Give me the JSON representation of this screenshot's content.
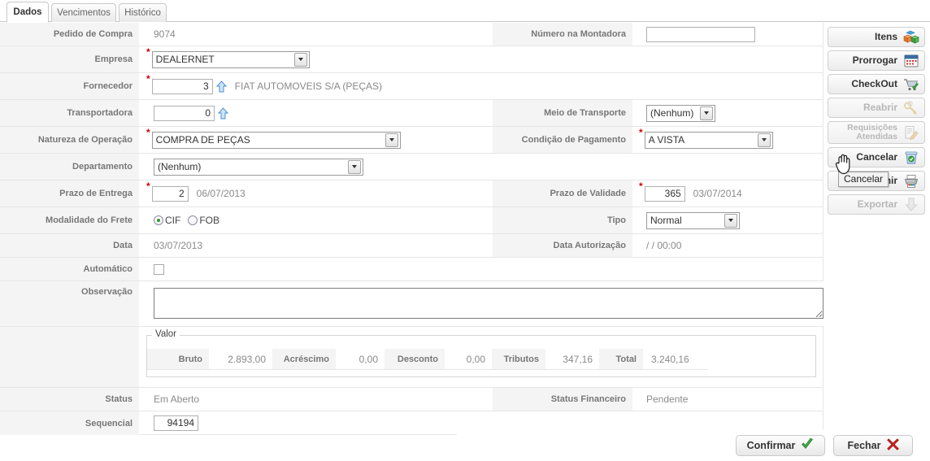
{
  "tabs": [
    {
      "label": "Dados",
      "active": true
    },
    {
      "label": "Vencimentos",
      "active": false
    },
    {
      "label": "Histórico",
      "active": false
    }
  ],
  "fields": {
    "pedido_de_compra": {
      "label": "Pedido de Compra",
      "value": "9074"
    },
    "numero_na_montadora": {
      "label": "Número na Montadora",
      "value": "",
      "placeholder": ""
    },
    "empresa": {
      "label": "Empresa",
      "value": "DEALERNET"
    },
    "fornecedor": {
      "label": "Fornecedor",
      "code": "3",
      "name": "FIAT AUTOMOVEIS S/A (PEÇAS)"
    },
    "transportadora": {
      "label": "Transportadora",
      "code": "0",
      "name": ""
    },
    "meio_de_transporte": {
      "label": "Meio de Transporte",
      "value": "(Nenhum)"
    },
    "natureza_de_operacao": {
      "label": "Natureza de Operação",
      "value": "COMPRA DE PEÇAS"
    },
    "condicao_de_pagamento": {
      "label": "Condição de Pagamento",
      "value": "A VISTA"
    },
    "departamento": {
      "label": "Departamento",
      "value": "(Nenhum)"
    },
    "prazo_de_entrega": {
      "label": "Prazo de Entrega",
      "days": "2",
      "date": "06/07/2013"
    },
    "prazo_de_validade": {
      "label": "Prazo de Validade",
      "days": "365",
      "date": "03/07/2014"
    },
    "modalidade_do_frete": {
      "label": "Modalidade do Frete",
      "options": [
        "CIF",
        "FOB"
      ],
      "selected": "CIF"
    },
    "tipo": {
      "label": "Tipo",
      "value": "Normal"
    },
    "data": {
      "label": "Data",
      "value": "03/07/2013"
    },
    "data_autorizacao": {
      "label": "Data Autorização",
      "value": "/ / 00:00"
    },
    "automatico": {
      "label": "Automático",
      "checked": false
    },
    "observacao": {
      "label": "Observação",
      "value": ""
    },
    "status": {
      "label": "Status",
      "value": "Em Aberto"
    },
    "status_financeiro": {
      "label": "Status Financeiro",
      "value": "Pendente"
    },
    "sequencial": {
      "label": "Sequencial",
      "value": "94194"
    }
  },
  "valor": {
    "legend": "Valor",
    "items": [
      {
        "label": "Bruto",
        "value": "2.893,00"
      },
      {
        "label": "Acréscimo",
        "value": "0,00"
      },
      {
        "label": "Desconto",
        "value": "0,00"
      },
      {
        "label": "Tributos",
        "value": "347,16"
      },
      {
        "label": "Total",
        "value": "3.240,16"
      }
    ]
  },
  "rail": [
    {
      "label": "Itens",
      "icon": "blocks-icon",
      "disabled": false,
      "two_line": false
    },
    {
      "label": "Prorrogar",
      "icon": "calendar-icon",
      "disabled": false,
      "two_line": false
    },
    {
      "label": "CheckOut",
      "icon": "cart-check-icon",
      "disabled": false,
      "two_line": false
    },
    {
      "label": "Reabrir",
      "icon": "keys-icon",
      "disabled": true,
      "two_line": false
    },
    {
      "label_line1": "Requisições",
      "label_line2": "Atendidas",
      "label": "Requisições Atendidas",
      "icon": "document-pencil-icon",
      "disabled": true,
      "two_line": true
    },
    {
      "label": "Cancelar",
      "icon": "trash-icon",
      "disabled": false,
      "two_line": false
    },
    {
      "label": "Imprimir",
      "icon": "printer-icon",
      "disabled": false,
      "two_line": false
    },
    {
      "label": "Exportar",
      "icon": "download-arrow-icon",
      "disabled": true,
      "two_line": false
    }
  ],
  "tooltip": {
    "text": "Cancelar"
  },
  "bottom": [
    {
      "label": "Confirmar",
      "icon": "green-check-icon"
    },
    {
      "label": "Fechar",
      "icon": "red-x-icon"
    }
  ],
  "colors": {
    "required_star": "#cc0000",
    "label_bg": "#f4f4f4",
    "label_text": "#777777",
    "value_text": "#8a8a8a",
    "confirm_check": "#33a02c",
    "close_x": "#cc2222",
    "radio_dot": "#2a9b2a"
  }
}
